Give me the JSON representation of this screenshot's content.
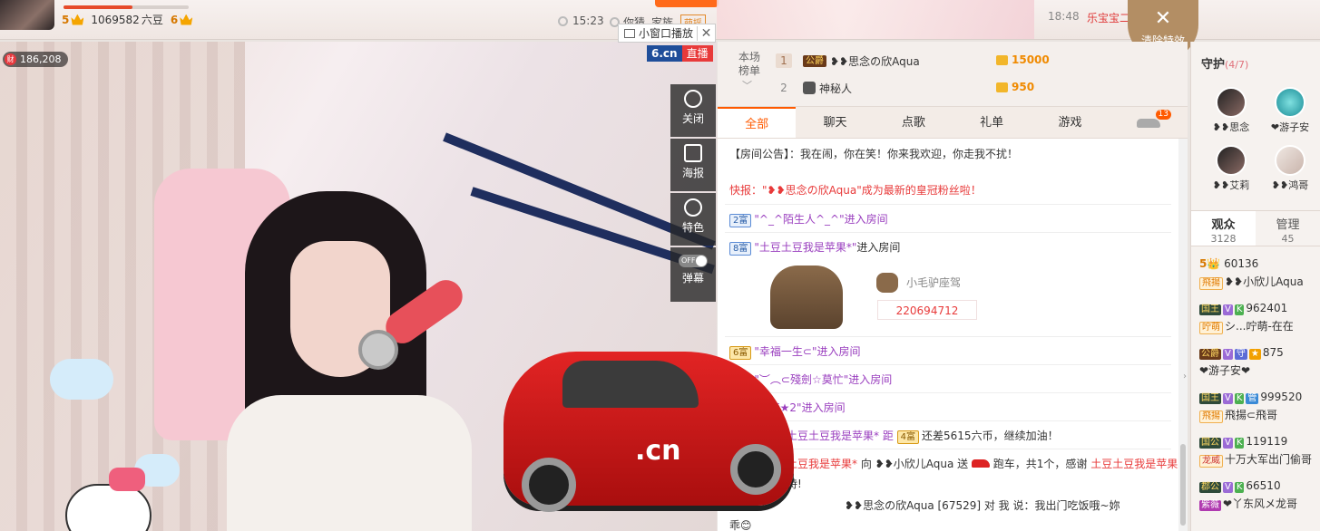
{
  "header": {
    "host_level": "5",
    "fans_count": "1069582",
    "currency": "六豆",
    "next_level": "6",
    "clock": "15:23",
    "guess": "你猜",
    "family": "家族",
    "family_badge": "萌摇",
    "time": "18:48",
    "marquee": "乐宝宝二 ... 简道D温柔 主播和房管 ",
    "clear_fx_label": "清除特效"
  },
  "video": {
    "wealth_icon": "财",
    "wealth": "186,208",
    "mini_window": "小窗口播放",
    "brand": "6.cn",
    "live": "直播",
    "car_logo": ".cn",
    "controls": [
      {
        "label": "关闭"
      },
      {
        "label": "海报"
      },
      {
        "label": "特色"
      },
      {
        "label": "弹幕",
        "toggle": "OFF"
      }
    ]
  },
  "rank": {
    "label": "本场榜单",
    "rows": [
      {
        "no": "1",
        "badge": "公爵",
        "name": "❥❥思念の欣Aqua",
        "amount": "15000"
      },
      {
        "no": "2",
        "badge": "",
        "name": "神秘人",
        "amount": "950"
      }
    ]
  },
  "tabs": {
    "items": [
      "全部",
      "聊天",
      "点歌",
      "礼单",
      "游戏"
    ],
    "count": "13"
  },
  "chat": {
    "notice_label": "【房间公告】",
    "notice": "：我在闹，你在笑！你来我欢迎，你走我不扰！",
    "flash": "快报：\"❥❥思念の欣Aqua\"成为最新的皇冠粉丝啦！",
    "enter1_lv": "2富",
    "enter1": "\"^_^陌生人^_^\"进入房间",
    "enter2_lv": "8富",
    "enter2_name": "\"土豆土豆我是苹果*\"",
    "enter2_suffix": "进入房间",
    "mount": "小毛驴座驾",
    "mount_id": "220694712",
    "enter3_lv": "6富",
    "enter3": "\"幸福一生⊂\"进入房间",
    "enter4_lv": "5富",
    "enter4": "\"︶︵⊂殘劍☆莫忙\"进入房间",
    "enter5_lv": "2富",
    "enter5": "\"★梦★2\"进入房间",
    "diff_name": "土豆土豆我是苹果* 距",
    "diff_lv": "4富",
    "diff_text": "还差5615六币，继续加油！",
    "gift_from": "土豆我是苹果*",
    "gift_mid": " 向 ❥❥小欣儿Aqua 送 ",
    "gift_item": " 跑车，共1个，感谢 ",
    "gift_thanks": "土豆土豆我是苹果",
    "gift_tail": "持!",
    "last_line": "❥❥思念の欣Aqua [67529] 对 我 说：我出门吃饭哦~妳",
    "last_line2": "乖😊"
  },
  "sidebar": {
    "guard_title": "守护",
    "guard_count": "(4/7)",
    "guards": [
      {
        "name": "❥❥思念"
      },
      {
        "name": "❤游子安"
      },
      {
        "name": "❥❥艾莉"
      },
      {
        "name": "❥❥鸿哥"
      }
    ],
    "audience_label": "观众",
    "audience_count": "3128",
    "admin_label": "管理",
    "admin_count": "45",
    "audience": [
      {
        "tags": [
          "5👑"
        ],
        "text": "60136"
      },
      {
        "tags": [
          "飛揚"
        ],
        "text": "❥❥小欣儿Aqua"
      },
      {
        "tags": [
          "国王",
          "V",
          "K"
        ],
        "text": "962401"
      },
      {
        "tags": [
          "咛萌"
        ],
        "text": "シ...咛萌-在在"
      },
      {
        "tags": [
          "公爵",
          "V",
          "守",
          "★"
        ],
        "text": "875"
      },
      {
        "tags": [],
        "text": "❤游子安❤"
      },
      {
        "tags": [
          "国王",
          "V",
          "K",
          "管"
        ],
        "text": "999520"
      },
      {
        "tags": [
          "飛揚"
        ],
        "text": "飛揚⊂飛哥"
      },
      {
        "tags": [
          "国公",
          "V",
          "K"
        ],
        "text": "119119"
      },
      {
        "tags": [
          "龙威"
        ],
        "text": "十万大军出门偷哥"
      },
      {
        "tags": [
          "郡公",
          "V",
          "K"
        ],
        "text": "66510"
      },
      {
        "tags": [
          "紫薇"
        ],
        "text": "❤丫东风メ龙哥"
      }
    ]
  },
  "colors": {
    "accent": "#ff5a00",
    "red": "#e83a3a",
    "gold": "#f08a00",
    "clear_fx_bg": "#b38e64"
  }
}
